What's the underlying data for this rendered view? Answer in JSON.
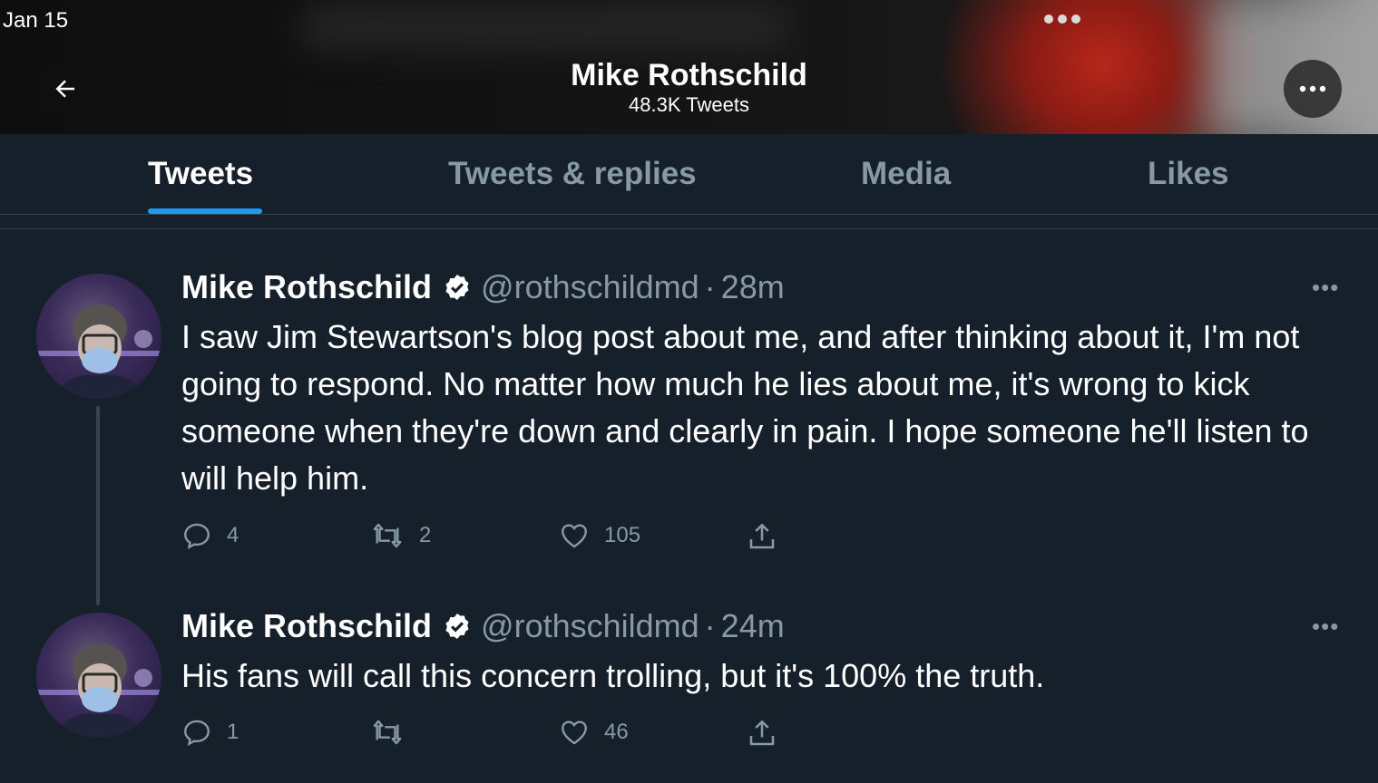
{
  "status_bar": {
    "date": "Jan 15"
  },
  "header": {
    "name": "Mike Rothschild",
    "tweet_count": "48.3K Tweets"
  },
  "tabs": [
    {
      "label": "Tweets",
      "active": true
    },
    {
      "label": "Tweets & replies",
      "active": false
    },
    {
      "label": "Media",
      "active": false
    },
    {
      "label": "Likes",
      "active": false
    }
  ],
  "tweets": [
    {
      "name": "Mike Rothschild",
      "handle": "@rothschildmd",
      "separator": "·",
      "time": "28m",
      "text": "I saw Jim Stewartson's blog post about me, and after thinking about it, I'm not going to respond. No matter how much he lies about me, it's wrong to kick someone when they're down and clearly in pain. I hope someone he'll listen to will help him.",
      "replies": "4",
      "retweets": "2",
      "likes": "105"
    },
    {
      "name": "Mike Rothschild",
      "handle": "@rothschildmd",
      "separator": "·",
      "time": "24m",
      "text": "His fans will call this concern trolling, but it's 100% the truth.",
      "replies": "1",
      "retweets": "",
      "likes": "46"
    }
  ],
  "colors": {
    "background": "#15202b",
    "accent": "#1d9bf0",
    "muted": "#8899a6",
    "divider": "#38444d"
  },
  "icons": [
    "back-arrow-icon",
    "more-icon",
    "verified-badge-icon",
    "reply-icon",
    "retweet-icon",
    "like-icon",
    "share-icon"
  ]
}
